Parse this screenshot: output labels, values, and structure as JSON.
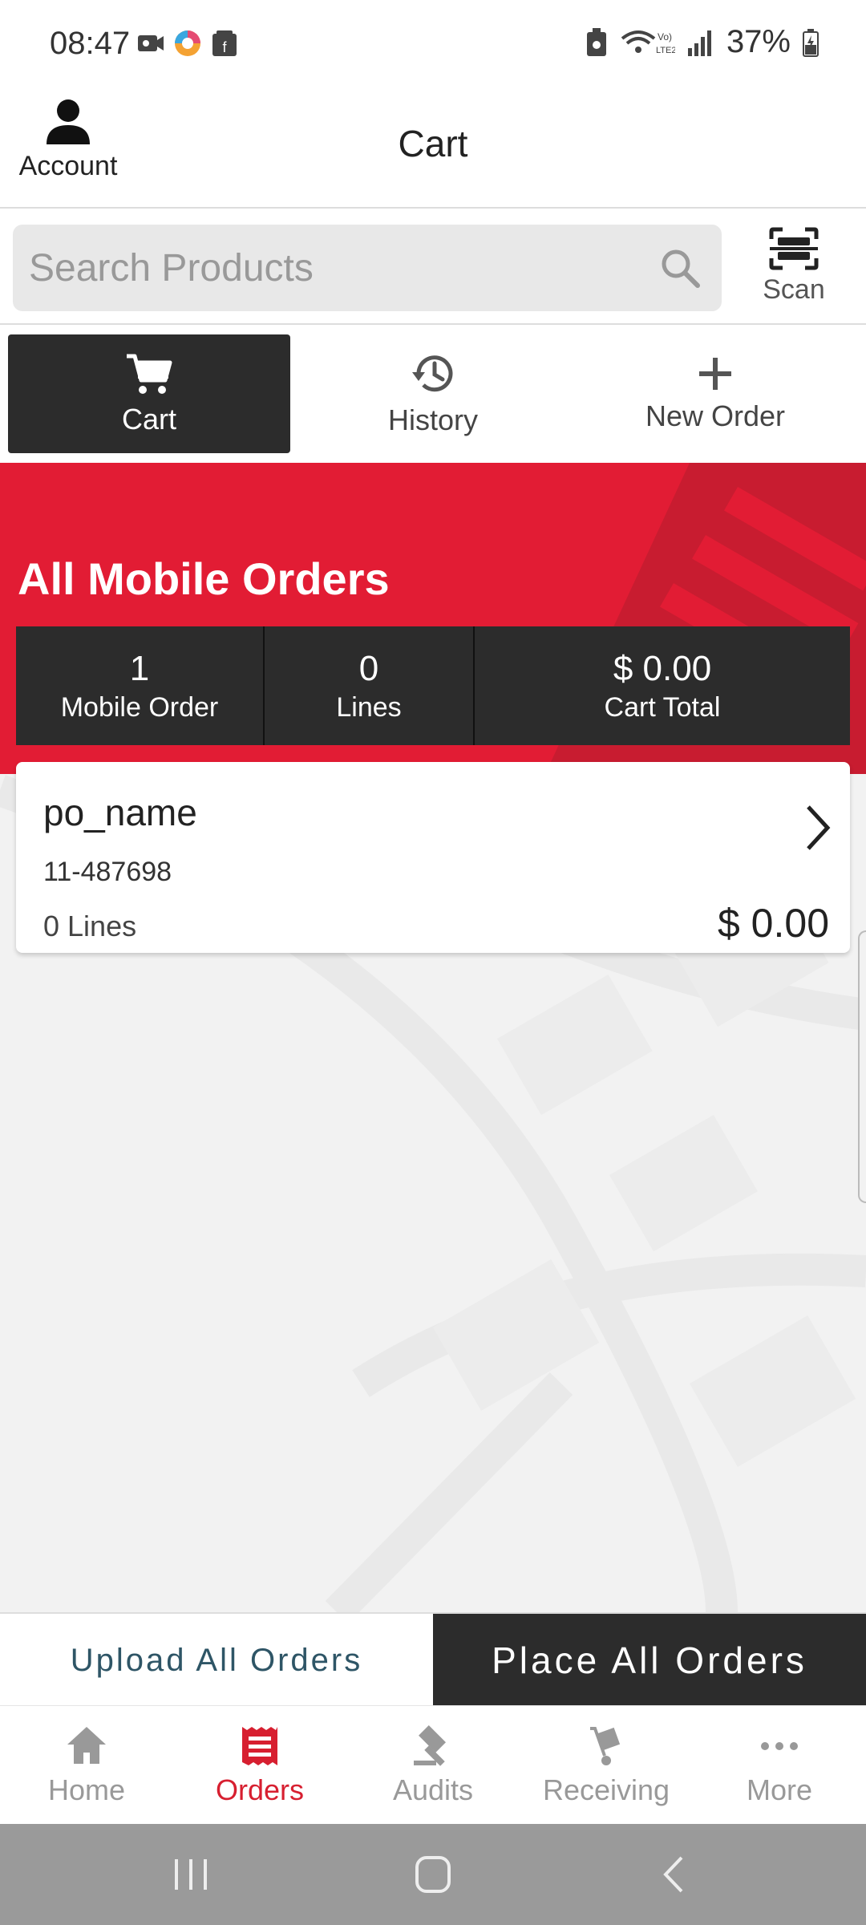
{
  "status_bar": {
    "time": "08:47",
    "battery": "37%"
  },
  "header": {
    "account_label": "Account",
    "title": "Cart"
  },
  "search": {
    "placeholder": "Search Products",
    "scan_label": "Scan"
  },
  "tabs": [
    {
      "label": "Cart",
      "icon": "cart-icon",
      "active": true
    },
    {
      "label": "History",
      "icon": "history-icon",
      "active": false
    },
    {
      "label": "New Order",
      "icon": "plus-icon",
      "active": false
    }
  ],
  "banner": {
    "title": "All Mobile Orders",
    "stats": [
      {
        "value": "1",
        "caption": "Mobile Order"
      },
      {
        "value": "0",
        "caption": "Lines"
      },
      {
        "value": "$ 0.00",
        "caption": "Cart Total"
      }
    ]
  },
  "orders": [
    {
      "name": "po_name",
      "number": "11-487698",
      "lines": "0 Lines",
      "total": "$ 0.00"
    }
  ],
  "actions": {
    "upload_label": "Upload All Orders",
    "place_label": "Place All Orders"
  },
  "bottom_nav": [
    {
      "label": "Home",
      "icon": "home-icon",
      "active": false
    },
    {
      "label": "Orders",
      "icon": "orders-icon",
      "active": true
    },
    {
      "label": "Audits",
      "icon": "gavel-icon",
      "active": false
    },
    {
      "label": "Receiving",
      "icon": "hand-truck-icon",
      "active": false
    },
    {
      "label": "More",
      "icon": "more-dots-icon",
      "active": false
    }
  ],
  "colors": {
    "brand_red": "#e21c34",
    "dark": "#2c2c2c",
    "active_nav": "#d71f30",
    "upload_text": "#2e5566"
  }
}
